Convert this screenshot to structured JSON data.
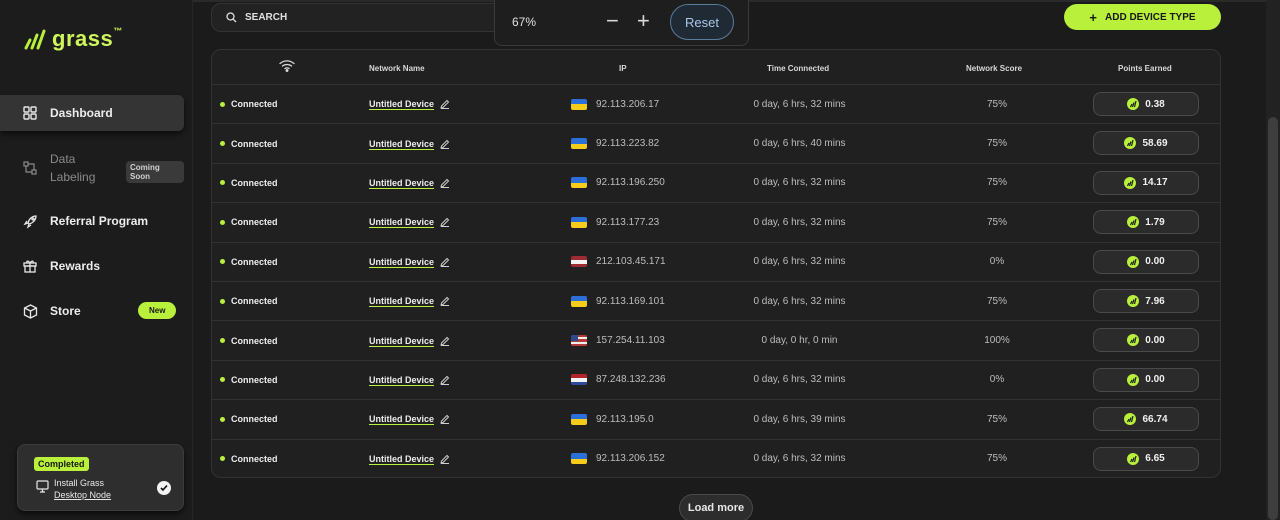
{
  "brand": {
    "name": "grass",
    "tm": "™",
    "color": "#b8f03c"
  },
  "nav": {
    "dashboard": "Dashboard",
    "data_labeling_1": "Data",
    "data_labeling_2": "Labeling",
    "coming_soon": "Coming Soon",
    "referral": "Referral Program",
    "rewards": "Rewards",
    "store": "Store",
    "new_badge": "New"
  },
  "task": {
    "badge": "Completed",
    "line1": "Install Grass",
    "line2": "Desktop Node"
  },
  "search": {
    "label": "SEARCH"
  },
  "zoom": {
    "value": "67%",
    "minus": "−",
    "plus": "+",
    "reset": "Reset"
  },
  "add_device": {
    "plus": "+",
    "label": "ADD DEVICE TYPE"
  },
  "table": {
    "headers": {
      "status_icon": "wifi-icon",
      "network_name": "Network Name",
      "ip": "IP",
      "time": "Time Connected",
      "score": "Network Score",
      "points": "Points Earned"
    },
    "rows": [
      {
        "status": "Connected",
        "name": "Untitled Device",
        "flag": "ua",
        "ip": "92.113.206.17",
        "time": "0 day, 6 hrs, 32 mins",
        "score": "75%",
        "points": "0.38"
      },
      {
        "status": "Connected",
        "name": "Untitled Device",
        "flag": "ua",
        "ip": "92.113.223.82",
        "time": "0 day, 6 hrs, 40 mins",
        "score": "75%",
        "points": "58.69"
      },
      {
        "status": "Connected",
        "name": "Untitled Device",
        "flag": "ua",
        "ip": "92.113.196.250",
        "time": "0 day, 6 hrs, 32 mins",
        "score": "75%",
        "points": "14.17"
      },
      {
        "status": "Connected",
        "name": "Untitled Device",
        "flag": "ua",
        "ip": "92.113.177.23",
        "time": "0 day, 6 hrs, 32 mins",
        "score": "75%",
        "points": "1.79"
      },
      {
        "status": "Connected",
        "name": "Untitled Device",
        "flag": "lv",
        "ip": "212.103.45.171",
        "time": "0 day, 6 hrs, 32 mins",
        "score": "0%",
        "points": "0.00"
      },
      {
        "status": "Connected",
        "name": "Untitled Device",
        "flag": "ua",
        "ip": "92.113.169.101",
        "time": "0 day, 6 hrs, 32 mins",
        "score": "75%",
        "points": "7.96"
      },
      {
        "status": "Connected",
        "name": "Untitled Device",
        "flag": "us",
        "ip": "157.254.11.103",
        "time": "0 day, 0 hr, 0 min",
        "score": "100%",
        "points": "0.00"
      },
      {
        "status": "Connected",
        "name": "Untitled Device",
        "flag": "nl",
        "ip": "87.248.132.236",
        "time": "0 day, 6 hrs, 32 mins",
        "score": "0%",
        "points": "0.00"
      },
      {
        "status": "Connected",
        "name": "Untitled Device",
        "flag": "ua",
        "ip": "92.113.195.0",
        "time": "0 day, 6 hrs, 39 mins",
        "score": "75%",
        "points": "66.74"
      },
      {
        "status": "Connected",
        "name": "Untitled Device",
        "flag": "ua",
        "ip": "92.113.206.152",
        "time": "0 day, 6 hrs, 32 mins",
        "score": "75%",
        "points": "6.65"
      }
    ]
  },
  "load_more": "Load more"
}
